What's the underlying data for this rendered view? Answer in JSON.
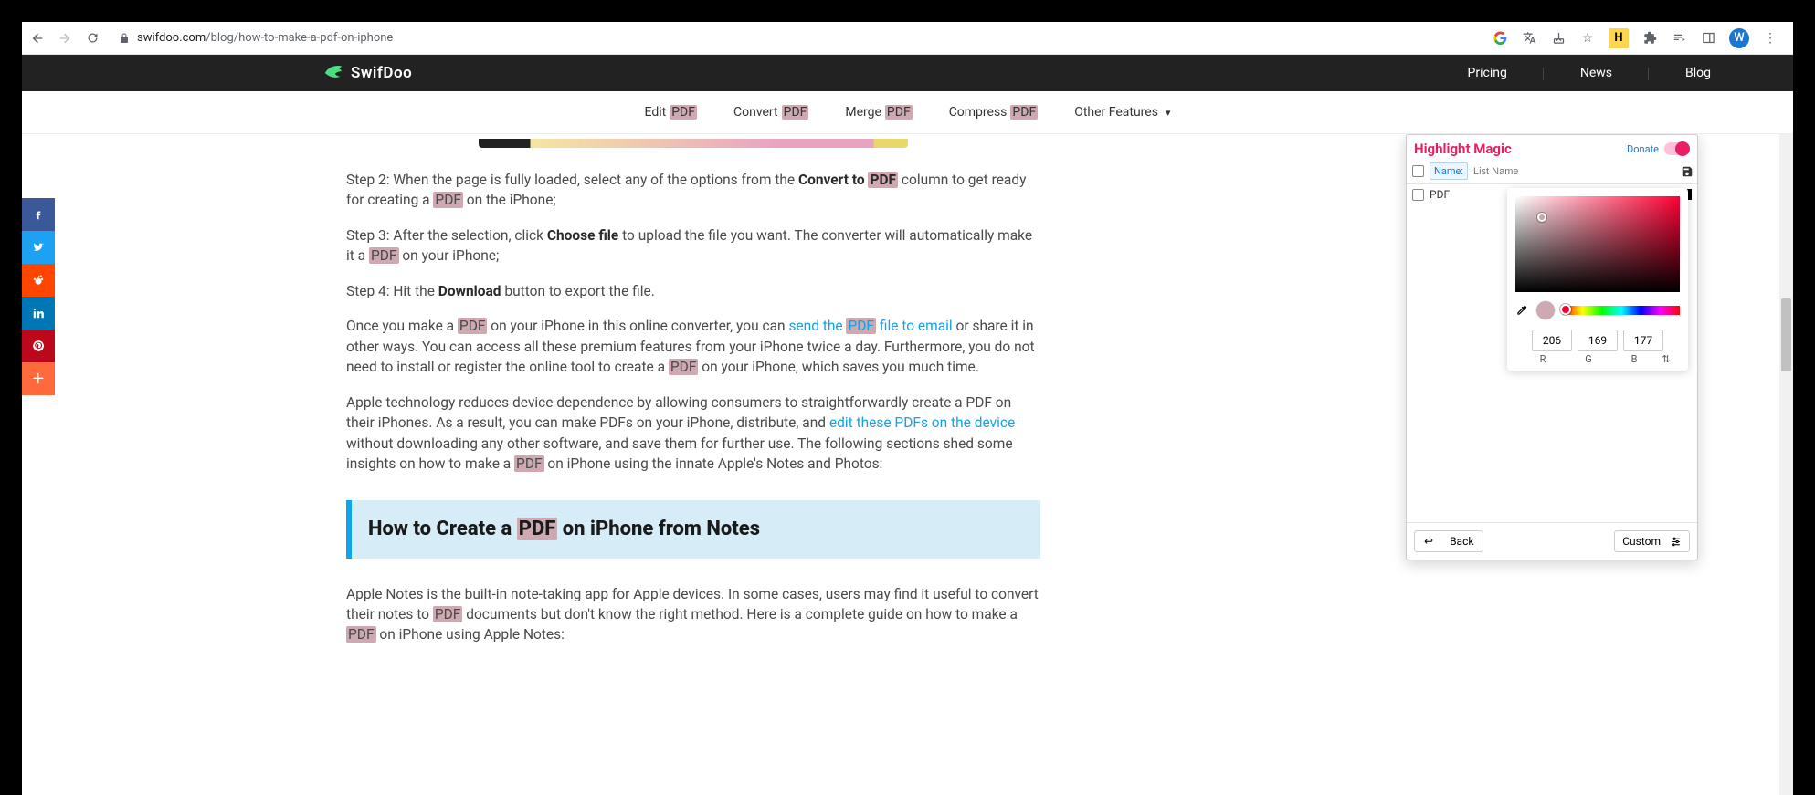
{
  "url": {
    "domain": "swifdoo.com",
    "path": "/blog/how-to-make-a-pdf-on-iphone"
  },
  "browser": {
    "avatar_initial": "W",
    "ext_badge": "H"
  },
  "logo": "SwifDoo",
  "top_nav": {
    "pricing": "Pricing",
    "news": "News",
    "blog": "Blog"
  },
  "sub_nav": {
    "edit_pre": "Edit ",
    "edit_hl": "PDF",
    "convert_pre": "Convert ",
    "convert_hl": "PDF",
    "merge_pre": "Merge ",
    "merge_hl": "PDF",
    "compress_pre": "Compress ",
    "compress_hl": "PDF",
    "other": "Other Features"
  },
  "article": {
    "p1a": "Step 2: When the page is fully loaded, select any of the options from the ",
    "p1b": "Convert to ",
    "p1hl": "PDF",
    "p1c": " column to get ready for creating a ",
    "p1hl2": "PDF",
    "p1d": " on the iPhone;",
    "p2a": "Step 3: After the selection, click ",
    "p2b": "Choose file",
    "p2c": " to upload the file you want. The converter will automatically make it a ",
    "p2hl": "PDF",
    "p2d": " on your iPhone;",
    "p3a": "Step 4: Hit the ",
    "p3b": "Download",
    "p3c": " button to export the file.",
    "p4a": "Once you make a ",
    "p4hl": "PDF",
    "p4b": " on your iPhone in this online converter, you can ",
    "p4link_pre": "send the ",
    "p4link_hl": "PDF",
    "p4link_post": " file to email",
    "p4c": " or share it in other ways. You can access all these premium features from your iPhone twice a day. Furthermore, you do not need to install or register the online tool to create a ",
    "p4hl2": "PDF",
    "p4d": " on your iPhone, which saves you much time.",
    "p5a": "Apple technology reduces device dependence by allowing consumers to straightforwardly create a PDF on their iPhones. As a result, you can make PDFs on your iPhone, distribute, and ",
    "p5link": "edit these PDFs on the device",
    "p5b": " without downloading any other software, and save them for further use. The following sections shed some insights on how to make a ",
    "p5hl": "PDF",
    "p5c": " on iPhone using the innate Apple's Notes and Photos:",
    "h2a": "How to Create a ",
    "h2hl": "PDF",
    "h2b": " on iPhone from Notes",
    "p6a": "Apple Notes is the built-in note-taking app for Apple devices. In some cases, users may find it useful to convert their notes to ",
    "p6hl": "PDF",
    "p6b": " documents but don't know the right method. Here is a complete guide on how to make a ",
    "p6hl2": "PDF",
    "p6c": " on iPhone using Apple Notes:"
  },
  "ext": {
    "title": "Highlight Magic",
    "donate": "Donate",
    "name_label": "Name:",
    "name_placeholder": "List Name",
    "term": "PDF",
    "rgb": {
      "r": "206",
      "g": "169",
      "b": "177",
      "rl": "R",
      "gl": "G",
      "bl": "B"
    },
    "back": "Back",
    "custom": "Custom"
  }
}
